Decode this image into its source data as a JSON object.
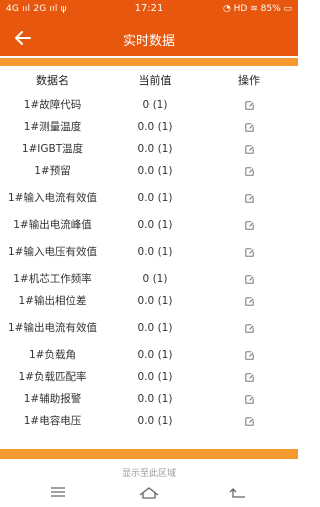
{
  "status_bar": {
    "left": "4G ııl 2G ııl ψ",
    "time": "17:21",
    "right": "◔ HD ≋ 85% ▭"
  },
  "app_bar": {
    "title": "实时数据",
    "back_icon": "arrow-left-icon"
  },
  "table": {
    "headers": {
      "name": "数据名",
      "value": "当前值",
      "operation": "操作"
    },
    "rows": [
      {
        "name": "1#故障代码",
        "value": "0 (1)"
      },
      {
        "name": "1#测量温度",
        "value": "0.0 (1)"
      },
      {
        "name": "1#IGBT温度",
        "value": "0.0 (1)"
      },
      {
        "name": "1#预留",
        "value": "0.0 (1)"
      },
      {
        "name": "1#输入电流有效值",
        "value": "0.0 (1)"
      },
      {
        "name": "1#输出电流峰值",
        "value": "0.0 (1)"
      },
      {
        "name": "1#输入电压有效值",
        "value": "0.0 (1)"
      },
      {
        "name": "1#机芯工作频率",
        "value": "0 (1)"
      },
      {
        "name": "1#输出相位差",
        "value": "0.0 (1)"
      },
      {
        "name": "1#输出电流有效值",
        "value": "0.0 (1)"
      },
      {
        "name": "1#负载角",
        "value": "0.0 (1)"
      },
      {
        "name": "1#负载匹配率",
        "value": "0.0 (1)"
      },
      {
        "name": "1#辅助报警",
        "value": "0.0 (1)"
      },
      {
        "name": "1#电容电压",
        "value": "0.0 (1)"
      }
    ],
    "edit_icon": "edit-icon"
  },
  "footer": {
    "note": "显示至此区域"
  },
  "nav_bar": {
    "menu_icon": "menu-icon",
    "home_icon": "home-icon",
    "back_icon": "back-icon"
  },
  "colors": {
    "primary": "#e8570e",
    "accent_strip": "#f59a2e"
  }
}
